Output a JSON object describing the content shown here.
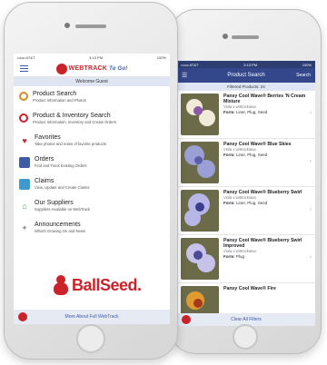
{
  "left_phone": {
    "status": {
      "carrier": "•••oo AT&T",
      "time": "3:13 PM",
      "battery": "100%"
    },
    "logo": {
      "brand": "WEBTRACK",
      "suffix": "To Go!"
    },
    "welcome": "Welcome Guest",
    "menu": [
      {
        "icon": "magnifier-icon",
        "title": "Product Search",
        "subtitle": "Product Information and Photos"
      },
      {
        "icon": "magnifier-icon",
        "title": "Product & Inventory Search",
        "subtitle": "Product Information, Inventory and Create Orders"
      },
      {
        "icon": "heart-icon",
        "title": "Favorites",
        "subtitle": "Take photos and notes of favorite products"
      },
      {
        "icon": "truck-icon",
        "title": "Orders",
        "subtitle": "Find and Track Existing Orders"
      },
      {
        "icon": "claims-icon",
        "title": "Claims",
        "subtitle": "View, Update and Create Claims"
      },
      {
        "icon": "house-icon",
        "title": "Our Suppliers",
        "subtitle": "Suppliers Available on WebTrack"
      },
      {
        "icon": "announcement-icon",
        "title": "Announcements",
        "subtitle": "What's Growing On and News"
      }
    ],
    "brand_logo": "BallSeed.",
    "footer": "More About Full WebTrack"
  },
  "right_phone": {
    "status": {
      "carrier": "•••oo AT&T",
      "time": "3:13 PM",
      "battery": "100%"
    },
    "nav_title": "Product Search",
    "nav_action": "Search",
    "filtered": "Filtered Products: 24",
    "products": [
      {
        "name": "Pansy Cool Wave® Berries 'N Cream Mixture",
        "sub": "Viola x wittrockiana",
        "form_label": "Form:",
        "form": "Liner, Plug, Seed",
        "colors": [
          "#f1ead9",
          "#8a5aa8"
        ]
      },
      {
        "name": "Pansy Cool Wave® Blue Skies",
        "sub": "Viola x wittrockiana",
        "form_label": "Form:",
        "form": "Liner, Plug, Seed",
        "colors": [
          "#9a9fd6",
          "#5c5fa8"
        ]
      },
      {
        "name": "Pansy Cool Wave® Blueberry Swirl",
        "sub": "Viola x wittrockiana",
        "form_label": "Form:",
        "form": "Liner, Plug, Seed",
        "colors": [
          "#b8b6e6",
          "#3b3e8c"
        ]
      },
      {
        "name": "Pansy Cool Wave® Blueberry Swirl Improved",
        "sub": "Viola x wittrockiana",
        "form_label": "Form:",
        "form": "Plug",
        "colors": [
          "#c6c2ea",
          "#4a4a96"
        ]
      },
      {
        "name": "Pansy Cool Wave® Fire",
        "sub": "",
        "form_label": "",
        "form": "",
        "colors": [
          "#e09a30",
          "#a53a1a"
        ]
      }
    ],
    "footer": "Clear All Filters"
  }
}
